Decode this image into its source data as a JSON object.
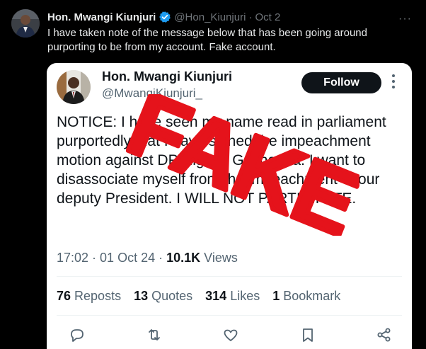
{
  "outer_post": {
    "name": "Hon. Mwangi Kiunjuri",
    "handle": "@Hon_Kiunjuri",
    "separator": "·",
    "date": "Oct 2",
    "more_label": "···",
    "text": "I have taken note of the message below that has been going around purporting to be from my account. Fake account."
  },
  "embedded_post": {
    "name": "Hon. Mwangi Kiunjuri",
    "handle": "@MwangiKiunjuri_",
    "follow_label": "Follow",
    "body": "NOTICE: I have seen my name read in parliament purportedly that I have signed the impeachment motion against DP Rigathi Gachagua. I want to disassociate myself from the impeachment of our deputy President. I WILL NOT PARTICIPATE.",
    "time": "17:02",
    "date": "01 Oct 24",
    "views_count": "10.1K",
    "views_label": "Views",
    "meta_separator": " · ",
    "stats": [
      {
        "count": "76",
        "label": "Reposts"
      },
      {
        "count": "13",
        "label": "Quotes"
      },
      {
        "count": "314",
        "label": "Likes"
      },
      {
        "count": "1",
        "label": "Bookmark"
      }
    ],
    "actions": [
      "reply-icon",
      "repost-icon",
      "like-icon",
      "bookmark-icon",
      "share-icon"
    ]
  },
  "stamp": {
    "text": "FAKE",
    "color": "#e5131b"
  },
  "colors": {
    "background": "#000000",
    "verified": "#1d9bf0",
    "muted": "#71767b",
    "card": "#ffffff"
  }
}
